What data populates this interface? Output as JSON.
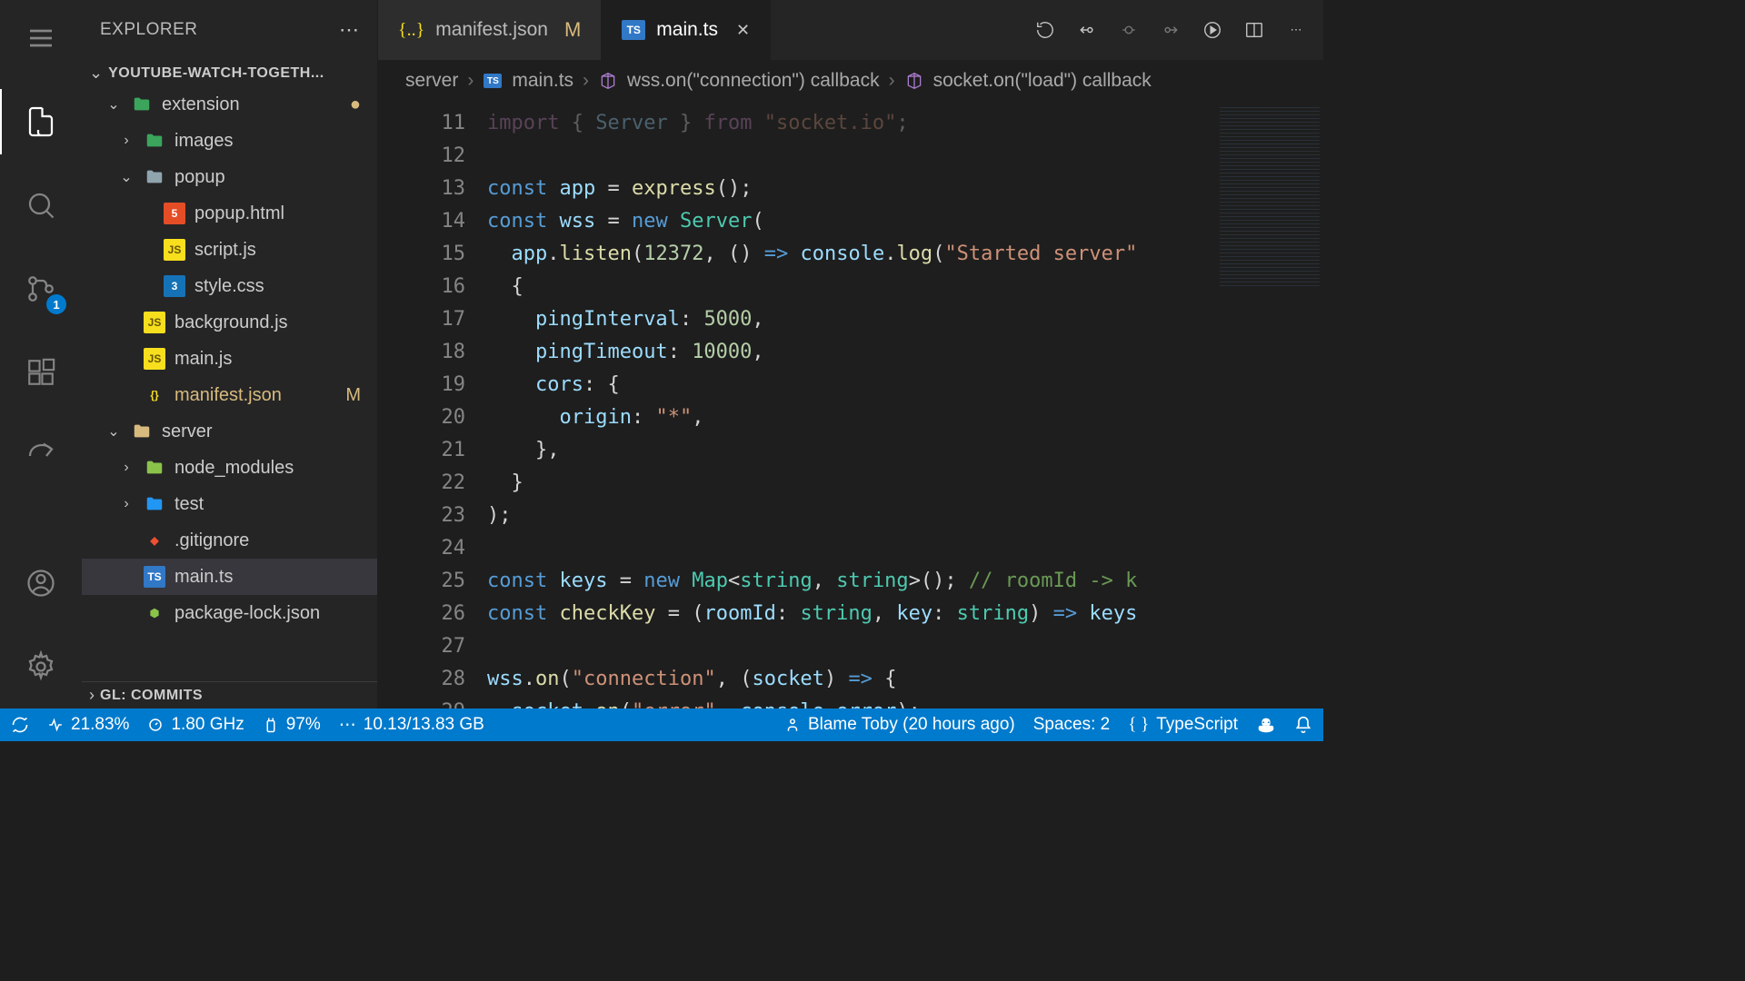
{
  "sidebar": {
    "title": "EXPLORER",
    "project": "YOUTUBE-WATCH-TOGETH...",
    "footerSection": "GL: COMMITS"
  },
  "activityBadge": "1",
  "tree": [
    {
      "name": "extension",
      "type": "folder",
      "depth": 0,
      "expanded": true,
      "status": "●",
      "color": "#3ba55c"
    },
    {
      "name": "images",
      "type": "folder",
      "depth": 1,
      "expanded": false,
      "color": "#3ba55c"
    },
    {
      "name": "popup",
      "type": "folder",
      "depth": 1,
      "expanded": true,
      "color": "#90a4ae"
    },
    {
      "name": "popup.html",
      "type": "file",
      "depth": 2,
      "iconText": "5",
      "iconBg": "#e44d26",
      "iconColor": "#fff"
    },
    {
      "name": "script.js",
      "type": "file",
      "depth": 2,
      "iconText": "JS",
      "iconBg": "#f7df1e",
      "iconColor": "#665500"
    },
    {
      "name": "style.css",
      "type": "file",
      "depth": 2,
      "iconText": "3",
      "iconBg": "#1572b6",
      "iconColor": "#fff"
    },
    {
      "name": "background.js",
      "type": "file",
      "depth": 1,
      "iconText": "JS",
      "iconBg": "#f7df1e",
      "iconColor": "#665500"
    },
    {
      "name": "main.js",
      "type": "file",
      "depth": 1,
      "iconText": "JS",
      "iconBg": "#f7df1e",
      "iconColor": "#665500"
    },
    {
      "name": "manifest.json",
      "type": "file",
      "depth": 1,
      "iconText": "{}",
      "iconBg": "transparent",
      "iconColor": "#f7df1e",
      "status": "M",
      "textColor": "#d7ba7d"
    },
    {
      "name": "server",
      "type": "folder",
      "depth": 0,
      "expanded": true,
      "color": "#d7ba7d"
    },
    {
      "name": "node_modules",
      "type": "folder",
      "depth": 1,
      "expanded": false,
      "color": "#8bc34a"
    },
    {
      "name": "test",
      "type": "folder",
      "depth": 1,
      "expanded": false,
      "color": "#2196f3"
    },
    {
      "name": ".gitignore",
      "type": "file",
      "depth": 1,
      "iconText": "◆",
      "iconBg": "transparent",
      "iconColor": "#f05032"
    },
    {
      "name": "main.ts",
      "type": "file",
      "depth": 1,
      "iconText": "TS",
      "iconBg": "#3178c6",
      "iconColor": "#fff",
      "selected": true
    },
    {
      "name": "package-lock.json",
      "type": "file",
      "depth": 1,
      "iconText": "⬢",
      "iconBg": "transparent",
      "iconColor": "#8bc34a"
    }
  ],
  "tabs": [
    {
      "label": "manifest.json",
      "iconText": "{..}",
      "iconColor": "#f7df1e",
      "modified": "M",
      "active": false
    },
    {
      "label": "main.ts",
      "iconText": "TS",
      "iconBg": "#3178c6",
      "iconColor": "#fff",
      "close": true,
      "active": true
    }
  ],
  "breadcrumb": {
    "parts": [
      "server",
      "main.ts",
      "wss.on(\"connection\") callback",
      "socket.on(\"load\") callback"
    ]
  },
  "code": {
    "startLine": 11,
    "lines": [
      {
        "html": "<span class='kw2'>import</span> <span class='punc'>{</span> <span class='id'>Server</span> <span class='punc'>}</span> <span class='kw2'>from</span> <span class='str'>\"socket.io\"</span><span class='punc'>;</span>",
        "dim": true
      },
      {
        "html": ""
      },
      {
        "html": "<span class='kw'>const</span> <span class='id'>app</span> <span class='punc'>=</span> <span class='fn'>express</span><span class='punc'>();</span>"
      },
      {
        "html": "<span class='kw'>const</span> <span class='id'>wss</span> <span class='punc'>=</span> <span class='kw'>new</span> <span class='cls'>Server</span><span class='punc'>(</span>"
      },
      {
        "html": "  <span class='id'>app</span><span class='punc'>.</span><span class='fn'>listen</span><span class='punc'>(</span><span class='num'>12372</span><span class='punc'>,</span> <span class='punc'>()</span> <span class='kw'>=&gt;</span> <span class='id'>console</span><span class='punc'>.</span><span class='fn'>log</span><span class='punc'>(</span><span class='str'>\"Started server\"</span>"
      },
      {
        "html": "  <span class='punc'>{</span>"
      },
      {
        "html": "    <span class='id'>pingInterval</span><span class='punc'>:</span> <span class='num'>5000</span><span class='punc'>,</span>"
      },
      {
        "html": "    <span class='id'>pingTimeout</span><span class='punc'>:</span> <span class='num'>10000</span><span class='punc'>,</span>"
      },
      {
        "html": "    <span class='id'>cors</span><span class='punc'>:</span> <span class='punc'>{</span>"
      },
      {
        "html": "      <span class='id'>origin</span><span class='punc'>:</span> <span class='str'>\"*\"</span><span class='punc'>,</span>"
      },
      {
        "html": "    <span class='punc'>},</span>"
      },
      {
        "html": "  <span class='punc'>}</span>"
      },
      {
        "html": "<span class='punc'>);</span>"
      },
      {
        "html": ""
      },
      {
        "html": "<span class='kw'>const</span> <span class='id'>keys</span> <span class='punc'>=</span> <span class='kw'>new</span> <span class='cls'>Map</span><span class='punc'>&lt;</span><span class='typ'>string</span><span class='punc'>,</span> <span class='typ'>string</span><span class='punc'>&gt;();</span> <span class='cmt'>// roomId -&gt; k</span>"
      },
      {
        "html": "<span class='kw'>const</span> <span class='fn'>checkKey</span> <span class='punc'>=</span> <span class='punc'>(</span><span class='param'>roomId</span><span class='punc'>:</span> <span class='typ'>string</span><span class='punc'>,</span> <span class='param'>key</span><span class='punc'>:</span> <span class='typ'>string</span><span class='punc'>)</span> <span class='kw'>=&gt;</span> <span class='id'>keys</span>"
      },
      {
        "html": ""
      },
      {
        "html": "<span class='id'>wss</span><span class='punc'>.</span><span class='fn'>on</span><span class='punc'>(</span><span class='str'>\"connection\"</span><span class='punc'>,</span> <span class='punc'>(</span><span class='param'>socket</span><span class='punc'>)</span> <span class='kw'>=&gt;</span> <span class='punc'>{</span>"
      },
      {
        "html": "  <span class='id'>socket</span><span class='punc'>.</span><span class='fn'>on</span><span class='punc'>(</span><span class='str'>\"error\"</span><span class='punc'>,</span> <span class='id'>console</span><span class='punc'>.</span><span class='id'>error</span><span class='punc'>);</span>"
      }
    ]
  },
  "status": {
    "cpu": "21.83%",
    "ghz": "1.80 GHz",
    "battery": "97%",
    "mem": "10.13/13.83 GB",
    "blame": "Blame Toby (20 hours ago)",
    "spaces": "Spaces: 2",
    "lang": "TypeScript"
  }
}
